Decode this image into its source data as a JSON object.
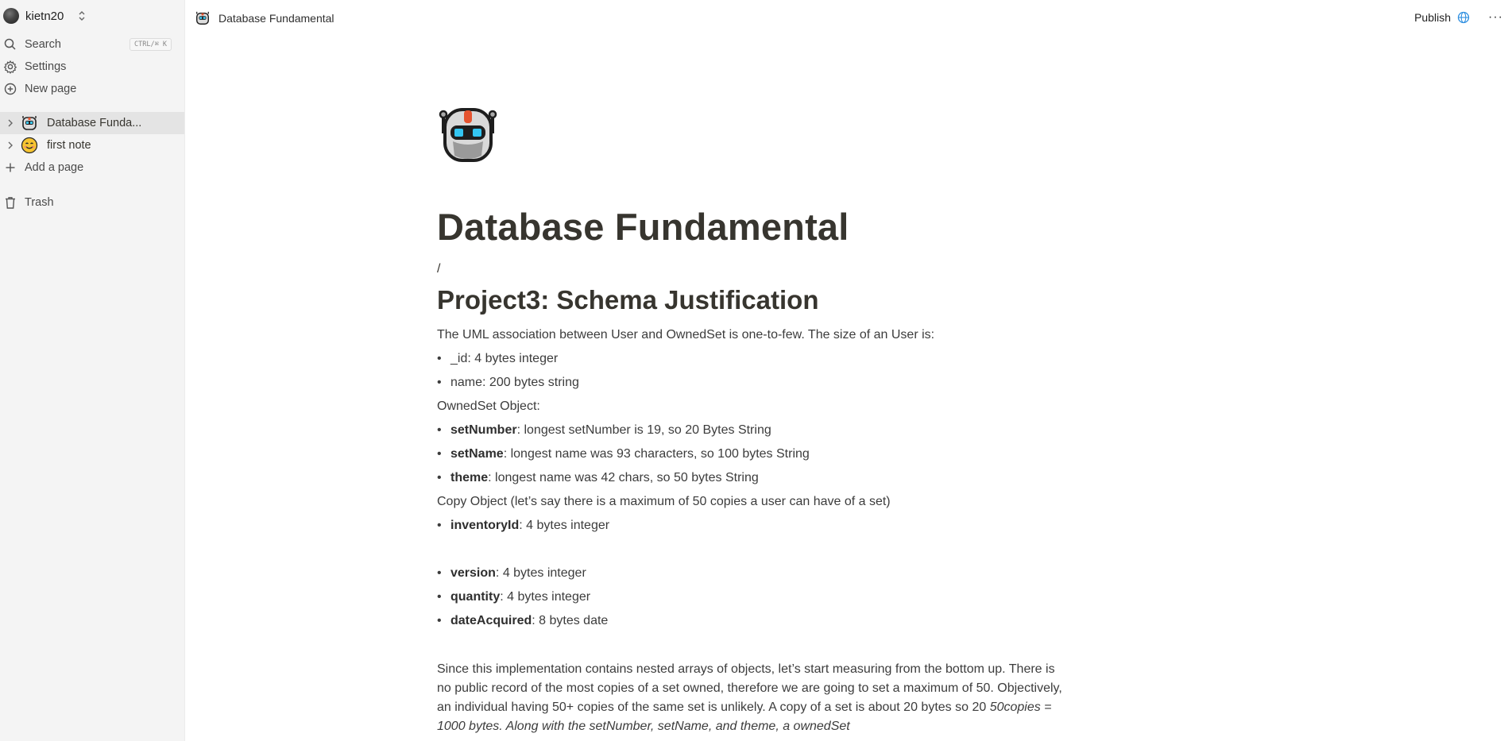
{
  "sidebar": {
    "workspace_name": "kietn20",
    "nav": {
      "search_label": "Search",
      "search_shortcut": "CTRL/⌘ K",
      "settings_label": "Settings",
      "new_page_label": "New page"
    },
    "pages": [
      {
        "label": "Database Funda...",
        "icon": "robot-emoji",
        "active": true
      },
      {
        "label": "first note",
        "icon": "smiling-face-emoji",
        "active": false
      }
    ],
    "add_page_label": "Add a page",
    "trash_label": "Trash"
  },
  "topbar": {
    "breadcrumb": "Database Fundamental",
    "publish_label": "Publish",
    "more_label": "···"
  },
  "document": {
    "icon": "robot-emoji",
    "title": "Database Fundamental",
    "slash": "/",
    "heading": "Project3: Schema Justification",
    "intro": "The UML association between User and OwnedSet is one-to-few. The size of an User is:",
    "user_fields": [
      {
        "text": "_id: 4 bytes integer"
      },
      {
        "text": "name: 200 bytes string"
      }
    ],
    "ownedset_label": "OwnedSet Object:",
    "ownedset_fields": [
      {
        "name": "setNumber",
        "desc": ": longest setNumber is 19, so 20 Bytes String"
      },
      {
        "name": "setName",
        "desc": ": longest name was 93 characters, so 100 bytes String"
      },
      {
        "name": "theme",
        "desc": ": longest name was 42 chars, so 50 bytes String"
      }
    ],
    "copy_label": "Copy Object (let’s say there is a maximum of 50 copies a user can have of a set)",
    "copy_fields": [
      {
        "name": "inventoryId",
        "desc": ": 4 bytes integer"
      },
      {
        "name": "version",
        "desc": ": 4 bytes integer"
      },
      {
        "name": "quantity",
        "desc": ": 4 bytes integer"
      },
      {
        "name": "dateAcquired",
        "desc": ": 8 bytes date"
      }
    ],
    "paragraph_main": "Since this implementation contains nested arrays of objects, let’s start measuring from the bottom up. There is no public record of the most copies of a set owned, therefore we are going to set a maximum of 50. Objectively, an individual having 50+ copies of the same set is unlikely. A copy of a set is about 20 bytes so 20 ",
    "paragraph_italic": " 50copies = 1000 bytes. Along with the setNumber, setName, and theme, a ownedSet"
  }
}
